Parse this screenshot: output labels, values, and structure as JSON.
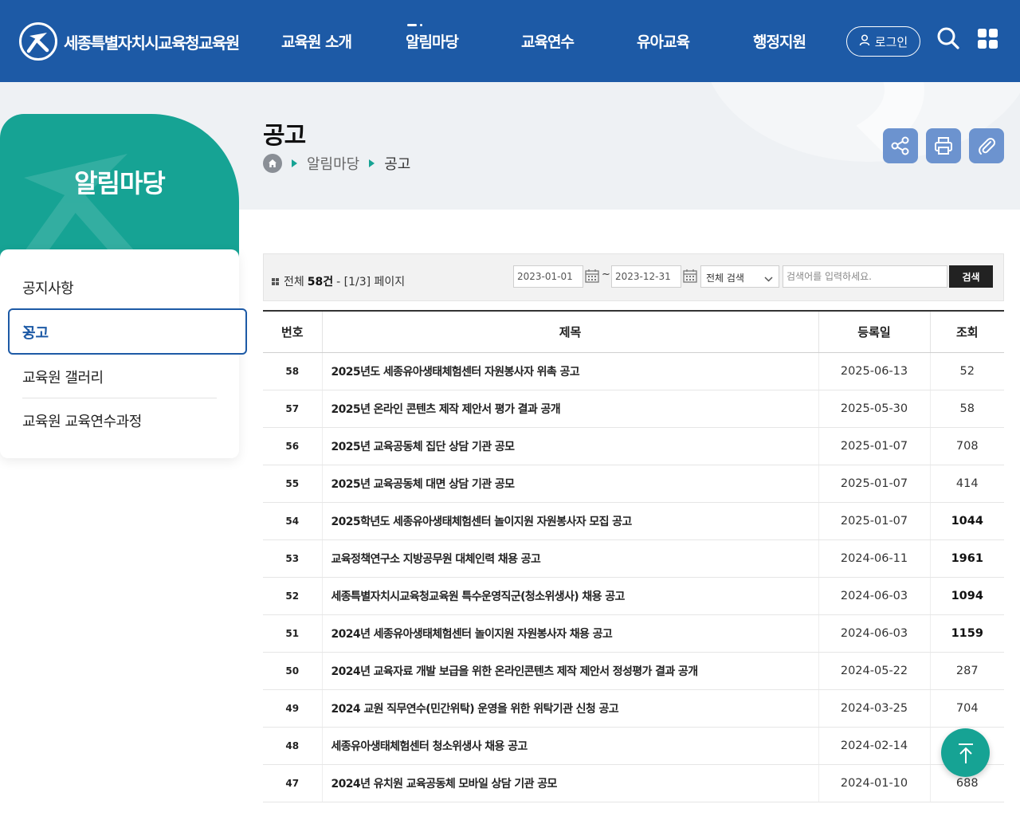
{
  "header": {
    "logo_text": "세종특별자치시교육청교육원",
    "nav": [
      {
        "label": "교육원 소개"
      },
      {
        "label": "알림마당"
      },
      {
        "label": "교육연수"
      },
      {
        "label": "유아교육"
      },
      {
        "label": "행정지원"
      }
    ],
    "login_label": "로그인",
    "icons": [
      "search-icon",
      "all-menu-icon",
      "user-icon"
    ]
  },
  "sidebar": {
    "title": "알림마당",
    "items": [
      {
        "label": "공지사항"
      },
      {
        "label": "공고"
      },
      {
        "label": "교육원 갤러리"
      },
      {
        "label": "교육원 교육연수과정"
      }
    ],
    "active_index": 1
  },
  "page": {
    "title": "공고",
    "breadcrumb": [
      "알림마당",
      "공고"
    ],
    "tools": [
      "share-icon",
      "print-icon",
      "attach-icon"
    ]
  },
  "search": {
    "total_prefix": "전체",
    "total_count": "58건",
    "page_info": "- [1/3] 페이지",
    "start_date": "2023-01-01",
    "tilde": "~",
    "end_date": "2023-12-31",
    "select_value": "전체 검색",
    "keyword_placeholder": "검색어를 입력하세요.",
    "button_label": "검색"
  },
  "board": {
    "headers": {
      "num": "번호",
      "subject": "제목",
      "date": "등록일",
      "hits": "조회"
    },
    "rows": [
      {
        "num": "58",
        "subject": "2025년도 세종유아생태체험센터 자원봉사자 위촉 공고",
        "date": "2025-06-13",
        "hits": "52"
      },
      {
        "num": "57",
        "subject": "2025년 온라인 콘텐츠 제작 제안서 평가 결과 공개",
        "date": "2025-05-30",
        "hits": "58"
      },
      {
        "num": "56",
        "subject": "2025년 교육공동체 집단 상담 기관 공모",
        "date": "2025-01-07",
        "hits": "708"
      },
      {
        "num": "55",
        "subject": "2025년 교육공동체 대면 상담 기관 공모",
        "date": "2025-01-07",
        "hits": "414"
      },
      {
        "num": "54",
        "subject": "2025학년도 세종유아생태체험센터 놀이지원 자원봉사자 모집 공고",
        "date": "2025-01-07",
        "hits": "1044"
      },
      {
        "num": "53",
        "subject": "교육정책연구소 지방공무원 대체인력 채용 공고",
        "date": "2024-06-11",
        "hits": "1961"
      },
      {
        "num": "52",
        "subject": "세종특별자치시교육청교육원 특수운영직군(청소위생사) 채용 공고",
        "date": "2024-06-03",
        "hits": "1094"
      },
      {
        "num": "51",
        "subject": "2024년 세종유아생태체험센터 놀이지원 자원봉사자 채용 공고",
        "date": "2024-06-03",
        "hits": "1159"
      },
      {
        "num": "50",
        "subject": "2024년 교육자료 개발 보급을 위한 온라인콘텐츠 제작 제안서 정성평가 결과 공개",
        "date": "2024-05-22",
        "hits": "287"
      },
      {
        "num": "49",
        "subject": "2024 교원 직무연수(민간위탁) 운영을 위한 위탁기관 신청 공고",
        "date": "2024-03-25",
        "hits": "704"
      },
      {
        "num": "48",
        "subject": "세종유아생태체험센터 청소위생사 채용 공고",
        "date": "2024-02-14",
        "hits": ""
      },
      {
        "num": "47",
        "subject": "2024년 유치원 교육공동체 모바일 상담 기관 공모",
        "date": "2024-01-10",
        "hits": "688"
      }
    ]
  },
  "colors": {
    "header_bg": "#1d5aa6",
    "accent_green": "#16a394",
    "tool_btn": "#6c93cf"
  },
  "top_button_icon": "arrow-up-icon"
}
